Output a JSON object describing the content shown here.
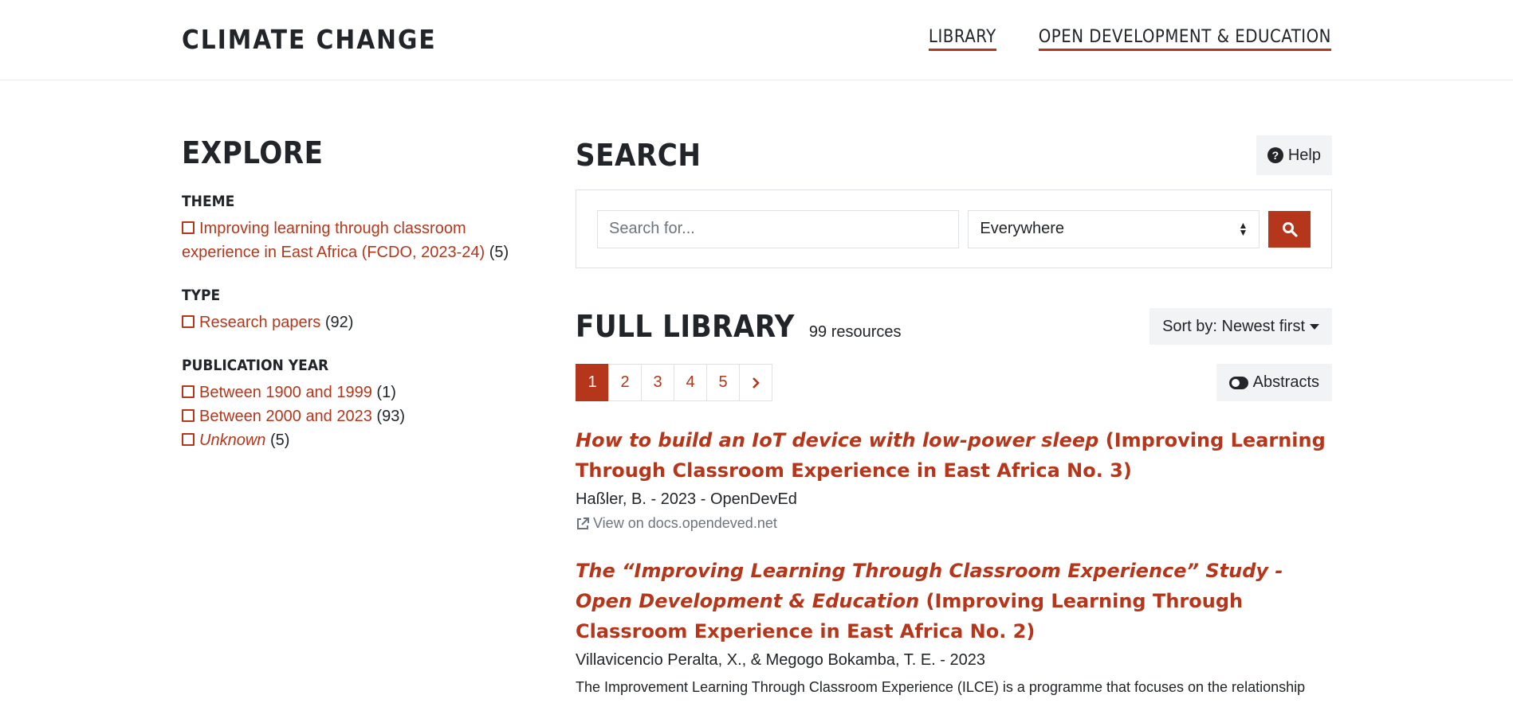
{
  "header": {
    "brand": "CLIMATE CHANGE",
    "nav": [
      "LIBRARY",
      "OPEN DEVELOPMENT & EDUCATION"
    ]
  },
  "sidebar": {
    "title": "EXPLORE",
    "theme": {
      "title": "THEME",
      "items": [
        {
          "label": "Improving learning through classroom experience in East Africa (FCDO, 2023-24)",
          "count": "(5)"
        }
      ]
    },
    "type": {
      "title": "TYPE",
      "items": [
        {
          "label": "Research papers",
          "count": "(92)"
        }
      ]
    },
    "year": {
      "title": "PUBLICATION YEAR",
      "items": [
        {
          "label": "Between 1900 and 1999",
          "count": "(1)"
        },
        {
          "label": "Between 2000 and 2023",
          "count": "(93)"
        },
        {
          "label": "Unknown",
          "count": "(5)"
        }
      ]
    }
  },
  "search": {
    "title": "SEARCH",
    "help_label": "Help",
    "placeholder": "Search for...",
    "scope": "Everywhere"
  },
  "library": {
    "title": "FULL LIBRARY",
    "count": "99 resources",
    "sort_label": "Sort by: Newest first",
    "pages": [
      "1",
      "2",
      "3",
      "4",
      "5"
    ],
    "abstracts_label": "Abstracts"
  },
  "results": [
    {
      "title_italic": "How to build an IoT device with low-power sleep",
      "title_series": "(Improving Learning Through Classroom Experience in East Africa No. 3)",
      "meta": "Haßler, B. - 2023 - OpenDevEd",
      "link": "View on docs.opendeved.net"
    },
    {
      "title_italic": "The “Improving Learning Through Classroom Experience” Study - Open Development & Education",
      "title_series": "(Improving Learning Through Classroom Experience in East Africa No. 2)",
      "meta": "Villavicencio Peralta, X., & Megogo Bokamba, T. E. - 2023",
      "abstract": "The Improvement Learning Through Classroom Experience (ILCE) is a programme that focuses on the relationship"
    }
  ],
  "colors": {
    "accent": "#b5361b"
  }
}
